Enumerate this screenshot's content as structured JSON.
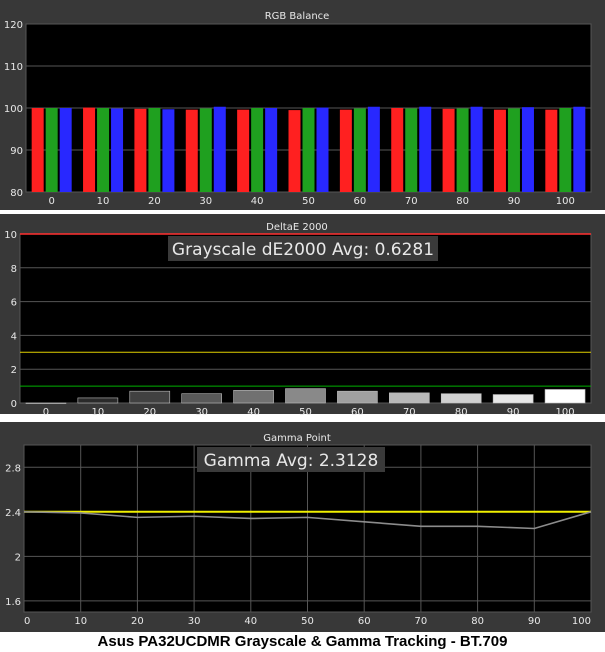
{
  "caption": "Asus PA32UCDMR Grayscale & Gamma Tracking - BT.709",
  "colors": {
    "panel_bg": "#383838",
    "plot_bg": "#000000",
    "grid": "#565656",
    "text": "#e8e8e8",
    "banner_bg": "#3a3a3a",
    "red": "#ff2020",
    "green": "#1fa01f",
    "blue": "#2828ff",
    "limit_red": "#ff3030",
    "limit_yellow": "#e0d000",
    "limit_green": "#00b000",
    "gamma_line": "#8c8c8c",
    "gamma_target": "#f0f000"
  },
  "chart_data": [
    {
      "type": "bar",
      "title": "RGB Balance",
      "categories": [
        "0",
        "10",
        "20",
        "30",
        "40",
        "50",
        "60",
        "70",
        "80",
        "90",
        "100"
      ],
      "ylim": [
        80,
        120
      ],
      "yticks": [
        80,
        90,
        100,
        110,
        120
      ],
      "grid": true,
      "series": [
        {
          "values": [
            100.0,
            100.1,
            99.8,
            99.6,
            99.6,
            99.5,
            99.6,
            100.0,
            99.8,
            99.6,
            99.6
          ]
        },
        {
          "values": [
            100.0,
            100.0,
            100.0,
            99.9,
            100.0,
            100.0,
            99.9,
            99.9,
            99.9,
            99.9,
            100.0
          ]
        },
        {
          "values": [
            100.0,
            99.9,
            99.7,
            100.3,
            100.0,
            100.1,
            100.3,
            100.3,
            100.3,
            100.2,
            100.3
          ]
        }
      ]
    },
    {
      "type": "bar",
      "title": "DeltaE 2000",
      "categories": [
        "0",
        "10",
        "20",
        "30",
        "40",
        "50",
        "60",
        "70",
        "80",
        "90",
        "100"
      ],
      "ylim": [
        0,
        10
      ],
      "yticks": [
        0,
        2,
        4,
        6,
        8,
        10
      ],
      "grid": true,
      "values": [
        0.0,
        0.3,
        0.7,
        0.55,
        0.75,
        0.85,
        0.7,
        0.6,
        0.55,
        0.5,
        0.8
      ],
      "limits": [
        1,
        3,
        10
      ],
      "annotation": "Grayscale dE2000 Avg: 0.6281"
    },
    {
      "type": "line",
      "title": "Gamma Point",
      "x": [
        0,
        10,
        20,
        30,
        40,
        50,
        60,
        70,
        80,
        90,
        100
      ],
      "xticks": [
        0,
        10,
        20,
        30,
        40,
        50,
        60,
        70,
        80,
        90,
        100
      ],
      "values": [
        2.4,
        2.39,
        2.35,
        2.36,
        2.34,
        2.35,
        2.31,
        2.27,
        2.27,
        2.25,
        2.4
      ],
      "target": 2.4,
      "ylim": [
        1.5,
        3.0
      ],
      "yticks": [
        1.6,
        2,
        2.4,
        2.8
      ],
      "grid": true,
      "annotation": "Gamma Avg: 2.3128"
    }
  ]
}
